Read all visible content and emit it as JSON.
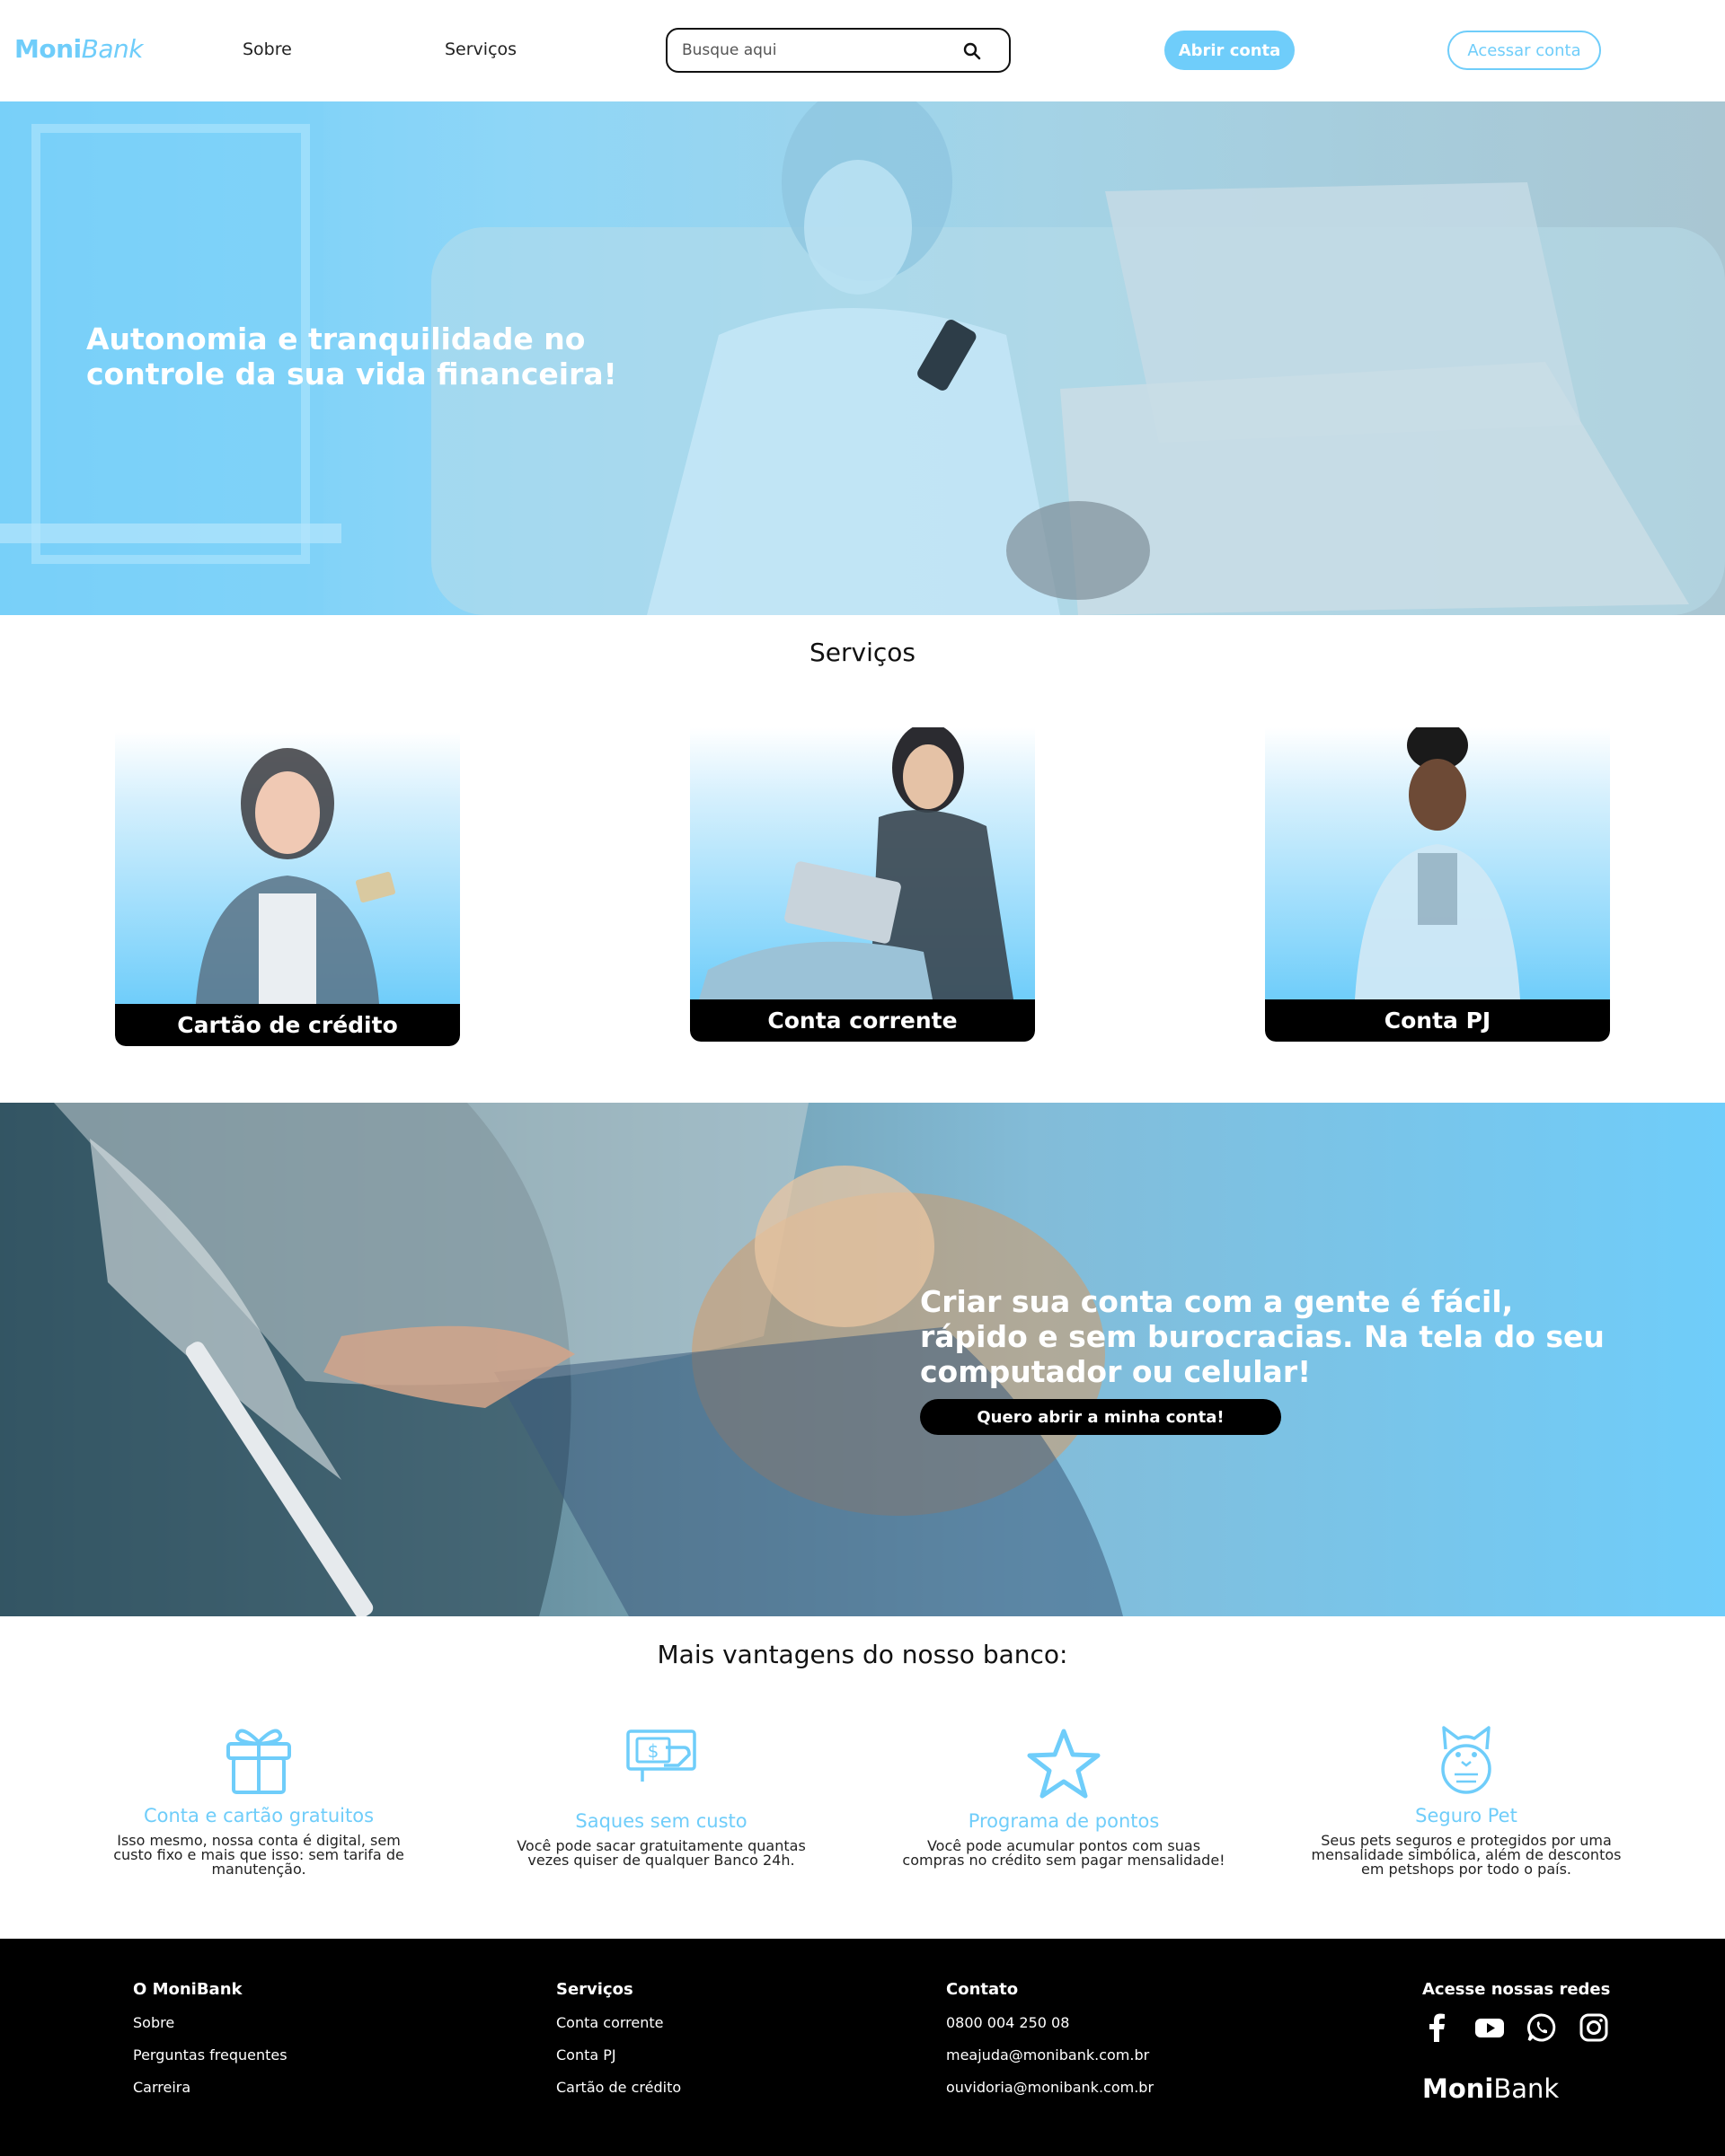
{
  "header": {
    "logo_part1": "Moni",
    "logo_part2": "Bank",
    "nav": [
      {
        "label": "Sobre"
      },
      {
        "label": "Serviços"
      }
    ],
    "search_placeholder": "Busque aqui",
    "open_account": "Abrir conta",
    "access_account": "Acessar conta"
  },
  "hero": {
    "title": "Autonomia e tranquilidade no controle da sua vida financeira!"
  },
  "services": {
    "title": "Serviços",
    "cards": [
      {
        "label": "Cartão de crédito"
      },
      {
        "label": "Conta corrente"
      },
      {
        "label": "Conta PJ"
      }
    ]
  },
  "promo": {
    "title": "Criar sua conta com a gente é fácil, rápido e sem burocracias. Na tela do seu computador ou celular!",
    "button": "Quero abrir a minha conta!"
  },
  "advantages": {
    "title": "Mais vantagens do nosso banco:",
    "items": [
      {
        "icon": "gift-icon",
        "title": "Conta e cartão gratuitos",
        "text": "Isso mesmo, nossa conta é digital, sem custo fixo e mais que isso: sem tarifa de manutenção."
      },
      {
        "icon": "cash-withdrawal-icon",
        "title": "Saques sem custo",
        "text": "Você pode sacar gratuitamente quantas vezes quiser de qualquer Banco 24h."
      },
      {
        "icon": "star-icon",
        "title": "Programa de pontos",
        "text": "Você pode acumular pontos com suas compras no crédito sem pagar mensalidade!"
      },
      {
        "icon": "cat-icon",
        "title": "Seguro Pet",
        "text": "Seus pets seguros e protegidos por uma mensalidade simbólica, além de descontos em petshops por todo o país."
      }
    ]
  },
  "footer": {
    "col1": {
      "heading": "O MoniBank",
      "links": [
        "Sobre",
        "Perguntas frequentes",
        "Carreira"
      ]
    },
    "col2": {
      "heading": "Serviços",
      "links": [
        "Conta corrente",
        "Conta PJ",
        "Cartão de crédito"
      ]
    },
    "col3": {
      "heading": "Contato",
      "links": [
        "0800 004 250 08",
        "meajuda@monibank.com.br",
        "ouvidoria@monibank.com.br"
      ]
    },
    "social_heading": "Acesse nossas redes",
    "social_icons": [
      "facebook-icon",
      "youtube-icon",
      "whatsapp-icon",
      "instagram-icon"
    ],
    "logo_part1": "Moni",
    "logo_part2": "Bank"
  },
  "colors": {
    "accent": "#6fcdfa",
    "footer_bg": "#000000",
    "text": "#111111"
  }
}
